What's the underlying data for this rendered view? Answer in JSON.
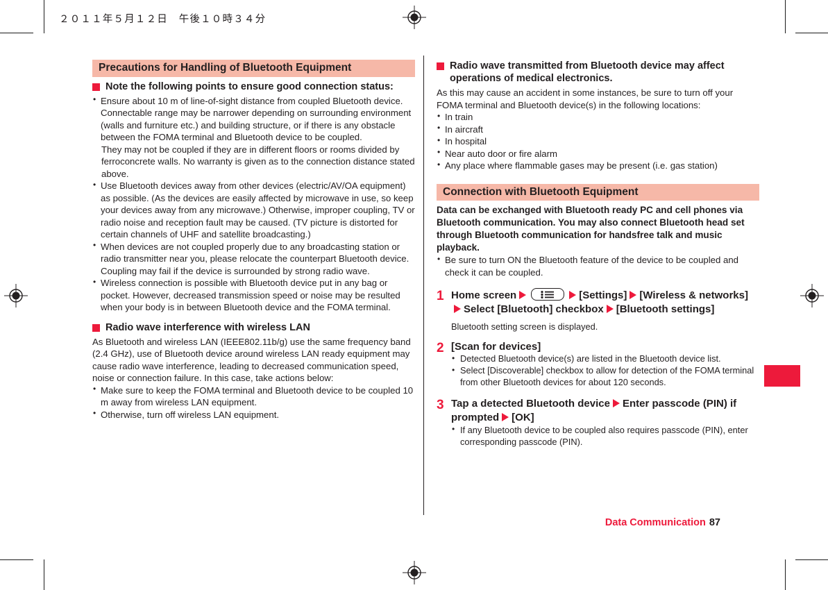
{
  "page": {
    "date_header": "２０１１年５月１２日　午後１０時３４分",
    "footer_label": "Data Communication",
    "footer_page": "87",
    "accent_red": "#ed1a3b",
    "band_pink": "#f6b8a8",
    "text_color": "#231f20"
  },
  "left_column": {
    "band_heading": "Precautions for Handling of Bluetooth Equipment",
    "heading_connection": "Note the following points to ensure good connection status:",
    "bullets": [
      "Ensure about 10 m of line-of-sight distance from coupled Bluetooth device. Connectable range may be narrower depending on surrounding environment (walls and furniture etc.) and building structure, or if there is any obstacle between the FOMA terminal and Bluetooth device to be coupled.",
      "Use Bluetooth devices away from other devices (electric/AV/OA equipment) as possible. (As the devices are easily affected by microwave in use, so keep your devices away from any microwave.) Otherwise, improper coupling, TV or radio noise and reception fault may be caused. (TV picture is distorted for certain channels of UHF and satellite broadcasting.)",
      "When devices are not coupled properly due to any broadcasting station or radio transmitter near you, please relocate the counterpart Bluetooth device. Coupling may fail if the device is surrounded by strong radio wave.",
      "Wireless connection is possible with Bluetooth device put in any bag or pocket. However, decreased transmission speed or noise may be resulted when your body is in between Bluetooth device and the FOMA terminal."
    ],
    "bullet1_continuation": "They may not be coupled if they are in different floors or rooms divided by ferroconcrete walls. No warranty is given as to the connection distance stated above.",
    "heading_wlan": "Radio wave interference with wireless LAN",
    "wlan_paragraph": "As Bluetooth and wireless LAN (IEEE802.11b/g) use the same frequency band (2.4 GHz), use of Bluetooth device around wireless LAN ready equipment may cause radio wave interference, leading to decreased communication speed, noise or connection failure. In this case, take actions below:",
    "wlan_bullets": [
      "Make sure to keep the FOMA terminal and Bluetooth device to be coupled 10 m away from wireless LAN equipment.",
      "Otherwise, turn off wireless LAN equipment."
    ]
  },
  "right_column": {
    "heading_medical": "Radio wave transmitted from Bluetooth device may affect operations of medical electronics.",
    "medical_paragraph": "As this may cause an accident in some instances, be sure to turn off your FOMA terminal and Bluetooth device(s) in the following locations:",
    "medical_bullets": [
      "In train",
      "In aircraft",
      "In hospital",
      "Near auto door or fire alarm",
      "Any place where flammable gases may be present (i.e. gas station)"
    ],
    "band_heading": "Connection with Bluetooth Equipment",
    "intro_bold": "Data can be exchanged with Bluetooth ready PC and cell phones via Bluetooth communication. You may also connect Bluetooth head set through Bluetooth communication for handsfree talk and music playback.",
    "intro_bullets": [
      "Be sure to turn ON the Bluetooth feature of the device to be coupled and check it can be coupled."
    ],
    "steps": [
      {
        "number": "1",
        "title_part1": "Home screen",
        "title_part2": "[Settings]",
        "title_part3": "[Wireless & networks]",
        "title_part4": "Select [Bluetooth] checkbox",
        "title_part5": "[Bluetooth settings]",
        "note": "Bluetooth setting screen is displayed."
      },
      {
        "number": "2",
        "title": "[Scan for devices]",
        "subs": [
          "Detected Bluetooth device(s) are listed in the Bluetooth device list.",
          "Select [Discoverable] checkbox to allow for detection of the FOMA terminal from other Bluetooth devices for about 120 seconds."
        ]
      },
      {
        "number": "3",
        "title_part1": "Tap a detected Bluetooth device",
        "title_part2": "Enter passcode (PIN) if prompted",
        "title_part3": "[OK]",
        "subs": [
          "If any Bluetooth device to be coupled also requires passcode (PIN), enter corresponding passcode (PIN)."
        ]
      }
    ]
  }
}
